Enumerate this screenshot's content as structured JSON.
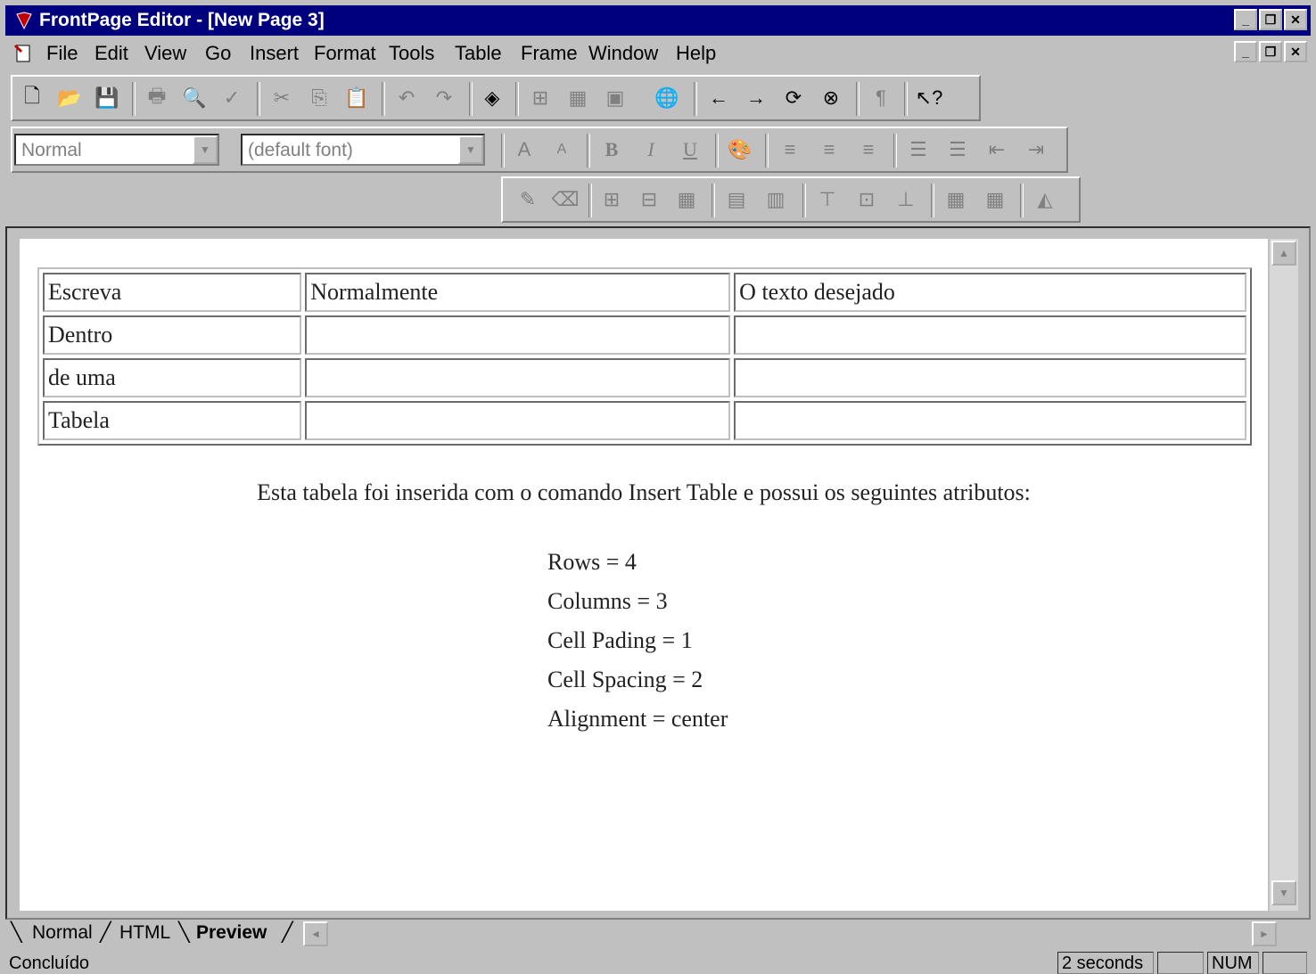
{
  "window": {
    "title": "FrontPage Editor - [New Page 3]"
  },
  "menu": [
    "File",
    "Edit",
    "View",
    "Go",
    "Insert",
    "Format",
    "Tools",
    "Table",
    "Frame",
    "Window",
    "Help"
  ],
  "format_toolbar": {
    "style_value": "Normal",
    "font_value": "(default font)"
  },
  "table": {
    "rows": [
      [
        "Escreva",
        "Normalmente",
        "O texto desejado"
      ],
      [
        "Dentro",
        "",
        ""
      ],
      [
        "de uma",
        "",
        ""
      ],
      [
        "Tabela",
        "",
        ""
      ]
    ]
  },
  "description": "Esta tabela foi inserida com o comando Insert Table e possui os seguintes atributos:",
  "attributes": [
    "Rows = 4",
    "Columns = 3",
    "Cell Pading = 1",
    "Cell Spacing = 2",
    "Alignment = center"
  ],
  "tabs": [
    "Normal",
    "HTML",
    "Preview"
  ],
  "active_tab": "Preview",
  "status": {
    "text": "Concluído",
    "time": "2 seconds",
    "num": "NUM"
  },
  "colors": {
    "title_bar": "#00007f",
    "chrome": "#c0c0c0"
  }
}
